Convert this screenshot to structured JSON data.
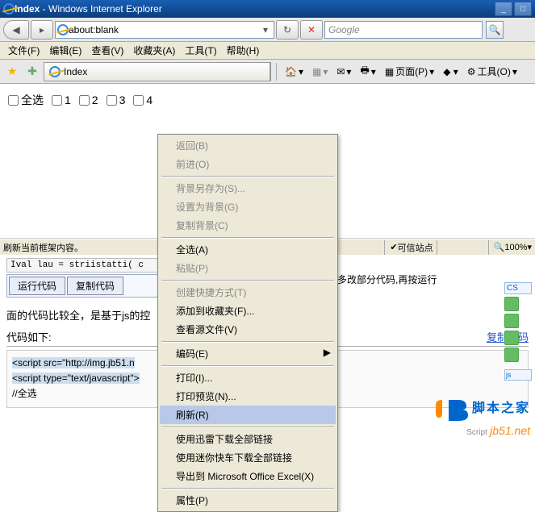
{
  "titlebar": {
    "title_prefix": "Index",
    "title_suffix": " - Windows Internet Explorer"
  },
  "nav": {
    "url": "about:blank",
    "refresh_glyph": "↻",
    "stop_glyph": "✕",
    "search_placeholder": "Google",
    "search_glyph": "🔍"
  },
  "menu": {
    "file": "文件(F)",
    "edit": "编辑(E)",
    "view": "查看(V)",
    "fav": "收藏夹(A)",
    "tools": "工具(T)",
    "help": "帮助(H)"
  },
  "toolbar": {
    "fav_glyph": "★",
    "addfav_glyph": "✚",
    "tab_label": "Index",
    "home_glyph": "🏠",
    "rss_glyph": "▦",
    "mail_glyph": "✉",
    "print_glyph": "🖶",
    "page_label": "页面(P)",
    "tools_label": "工具(O)"
  },
  "content": {
    "all_label": "全选",
    "items": [
      "1",
      "2",
      "3",
      "4"
    ]
  },
  "status": {
    "left": "刷新当前框架内容。",
    "trusted_label": "可信站点",
    "zoom_label": "100%"
  },
  "bg": {
    "code_fragment": "Ival lau = striistatti( c",
    "run_btn": "运行代码",
    "copy_btn": "复制代码",
    "note_right": "多改部分代码,再按运行",
    "desc": "面的代码比较全，是基于js的控",
    "code_header": "代码如下:",
    "copy_link": "复制代码",
    "line1a": "<script src=\"http://img.jb51.n",
    "line1b": "",
    "line2": "<script type=\"text/javascript\">",
    "line3": "//全选"
  },
  "logo": {
    "name": "脚本之家",
    "domain": "jb51.net",
    "script": "Script"
  },
  "ctx": {
    "back": "返回(B)",
    "forward": "前进(O)",
    "saveas": "背景另存为(S)...",
    "setbg": "设置为背景(G)",
    "copybg": "复制背景(C)",
    "selall": "全选(A)",
    "paste": "粘贴(P)",
    "shortcut": "创建快捷方式(T)",
    "addfav": "添加到收藏夹(F)...",
    "viewsrc": "查看源文件(V)",
    "encoding": "编码(E)",
    "print": "打印(I)...",
    "preview": "打印预览(N)...",
    "refresh": "刷新(R)",
    "thunder_all": "使用迅雷下载全部链接",
    "kuaiche_all": "使用迷你快车下载全部链接",
    "export_excel": "导出到 Microsoft Office Excel(X)",
    "props": "属性(P)"
  }
}
